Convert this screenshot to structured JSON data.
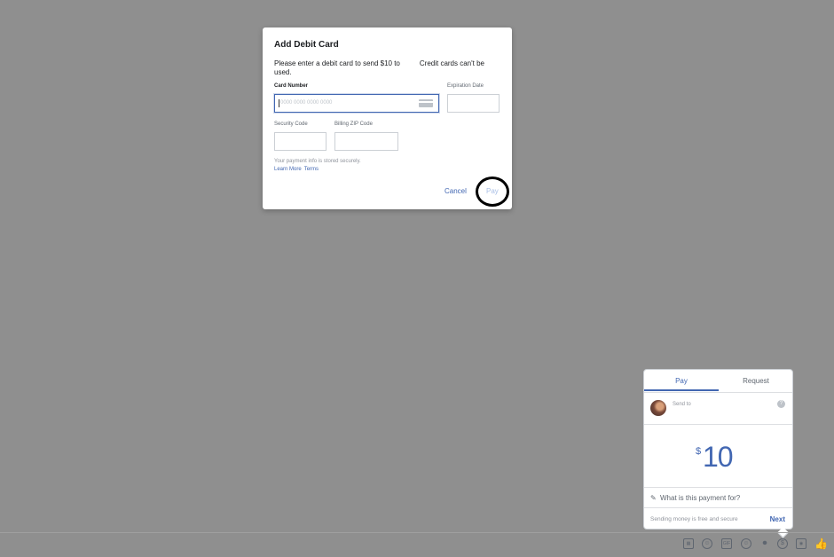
{
  "modal": {
    "title": "Add Debit Card",
    "description_part1": "Please enter a debit card to send $10 to",
    "description_part2": "Credit cards can't be used.",
    "card_number_label": "Card Number",
    "card_number_placeholder": "0000 0000 0000 0000",
    "expiration_label": "Expiration Date",
    "security_code_label": "Security Code",
    "zip_label": "Billing ZIP Code",
    "storage_note": "Your payment info is stored securely.",
    "learn_more": "Learn More",
    "terms": "Terms",
    "cancel_label": "Cancel",
    "pay_label": "Pay"
  },
  "payment_panel": {
    "tabs": [
      "Pay",
      "Request"
    ],
    "active_tab": "Pay",
    "send_to_label": "Send to",
    "help_glyph": "?",
    "currency": "$",
    "amount": "10",
    "purpose_placeholder": "What is this payment for?",
    "footer_note": "Sending money is free and secure",
    "next_label": "Next"
  },
  "composer_icons": [
    "sticker-icon",
    "emoji-sticker-icon",
    "gif-icon",
    "smiley-icon",
    "microphone-icon",
    "payment-icon",
    "camera-icon",
    "thumbs-up-icon"
  ],
  "colors": {
    "accent": "#4267b2",
    "overlay": "#8f8f8f"
  }
}
